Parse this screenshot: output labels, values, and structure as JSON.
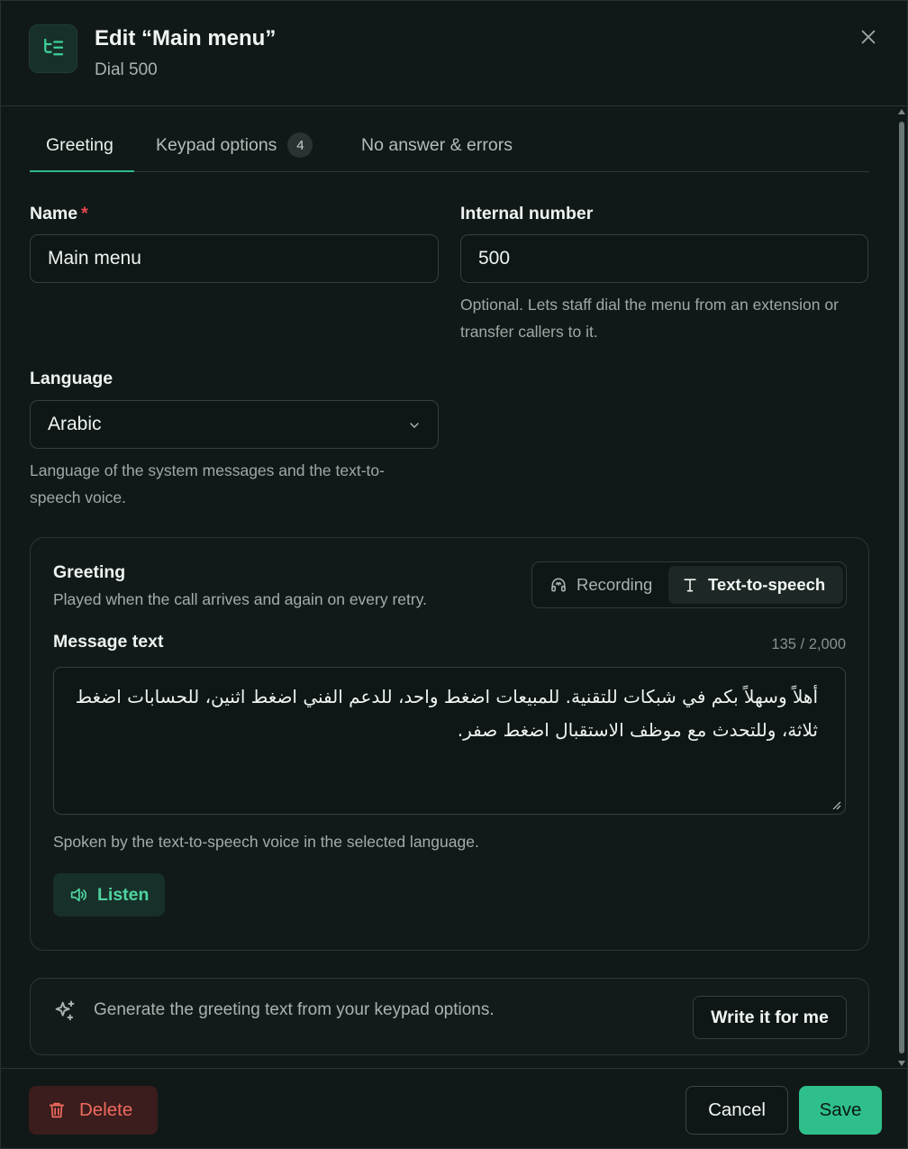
{
  "header": {
    "title": "Edit “Main menu”",
    "subtitle": "Dial 500",
    "icon": "menu-tree-icon",
    "close_icon": "close-icon"
  },
  "tabs": [
    {
      "label": "Greeting",
      "active": true
    },
    {
      "label": "Keypad options",
      "badge": "4"
    },
    {
      "label": "No answer & errors"
    }
  ],
  "form": {
    "name": {
      "label": "Name",
      "required_mark": "*",
      "value": "Main menu"
    },
    "internal_number": {
      "label": "Internal number",
      "value": "500",
      "help": "Optional. Lets staff dial the menu from an extension or transfer callers to it."
    },
    "language": {
      "label": "Language",
      "value": "Arabic",
      "help": "Language of the system messages and the text-to-speech voice."
    }
  },
  "greeting": {
    "title": "Greeting",
    "description": "Played when the call arrives and again on every retry.",
    "modes": [
      {
        "label": "Recording",
        "icon": "headphones-icon",
        "selected": false
      },
      {
        "label": "Text-to-speech",
        "icon": "text-icon",
        "selected": true
      }
    ],
    "message_label": "Message text",
    "counter": "135 / 2,000",
    "message_text": "أهلاً وسهلاً بكم في شبكات للتقنية. للمبيعات اضغط واحد، للدعم الفني اضغط اثنين، للحسابات اضغط ثلاثة، وللتحدث مع موظف الاستقبال اضغط صفر.",
    "help": "Spoken by the text-to-speech voice in the selected language.",
    "listen_label": "Listen"
  },
  "generate": {
    "text": "Generate the greeting text from your keypad options.",
    "button_label": "Write it for me"
  },
  "footer": {
    "delete_label": "Delete",
    "cancel_label": "Cancel",
    "save_label": "Save"
  },
  "colors": {
    "accent": "#2fbf8a",
    "danger": "#f06a5f",
    "background": "#111918"
  }
}
